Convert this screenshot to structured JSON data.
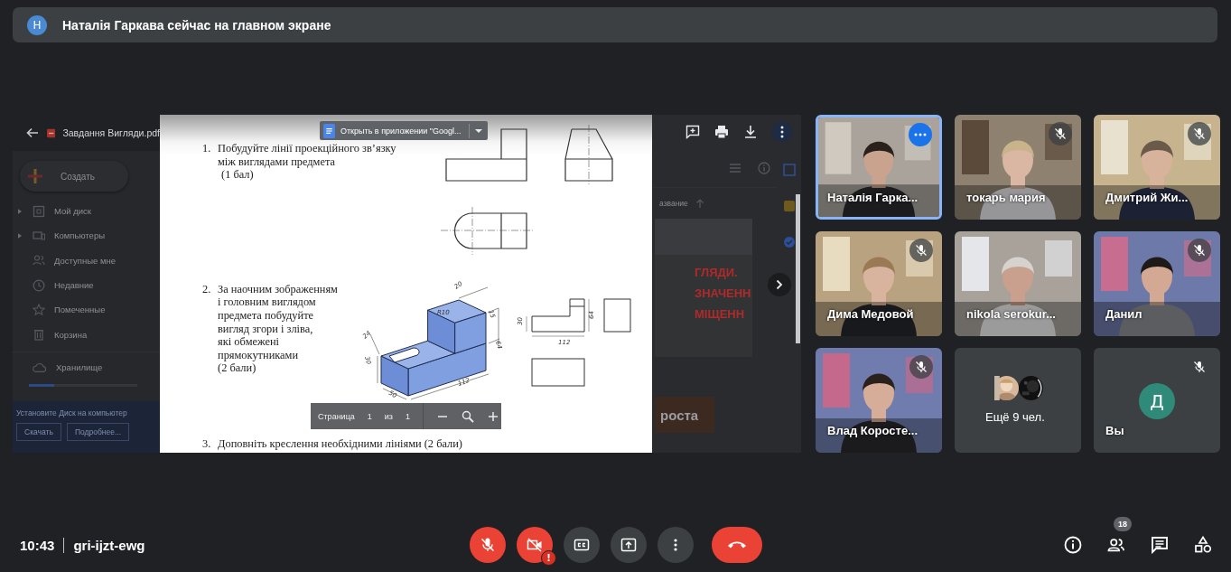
{
  "banner": {
    "avatar": "Н",
    "text": "Наталія Гаркава сейчас на главном экране"
  },
  "shared_screen": {
    "drive": {
      "file_name": "Завдання Вигляди.pdf",
      "create": "Создать",
      "storage": "Хранилище",
      "install": "Установите Диск на компьютер",
      "download": "Скачать",
      "more_info": "Подробнее...",
      "items": [
        {
          "label": "Мой диск",
          "expandable": true
        },
        {
          "label": "Компьютеры",
          "expandable": true
        },
        {
          "label": "Доступные мне",
          "expandable": false
        },
        {
          "label": "Недавние",
          "expandable": false
        },
        {
          "label": "Помеченные",
          "expandable": false
        },
        {
          "label": "Корзина",
          "expandable": false
        }
      ]
    },
    "open_in_app": "Открыть в приложении \"Googl...",
    "tasks": [
      {
        "number": "1.",
        "lines": [
          "Побудуйте лінії проекційного зв’язку",
          "між виглядами предмета",
          "(1 бал)"
        ]
      },
      {
        "number": "2.",
        "lines": [
          "За наочним зображенням",
          "і головним виглядом",
          "предмета побудуйте",
          "вигляд згори і зліва,",
          "які обмежені",
          "прямокутниками",
          "(2 бали)"
        ]
      },
      {
        "number": "3.",
        "lines": [
          "Доповніть креслення необхідними лініями (2 бали)"
        ]
      }
    ],
    "iso_dimensions": [
      "20",
      "15",
      "64",
      "R10",
      "24",
      "30",
      "50",
      "112"
    ],
    "view_dimensions": [
      "30",
      "64",
      "112"
    ],
    "pager": {
      "label": "Страница",
      "current": "1",
      "of": "из",
      "total": "1"
    },
    "background": {
      "sort_label": "азвание",
      "headings": [
        "ГЛЯДИ.",
        "ЗНАЧЕНН",
        "МІЩЕНН"
      ],
      "thumbnail_text": "роста"
    }
  },
  "participants": [
    {
      "kind": "video",
      "name": "Наталія Гарка...",
      "muted": false,
      "selected": true
    },
    {
      "kind": "video",
      "name": "токарь мария",
      "muted": true,
      "selected": false
    },
    {
      "kind": "video",
      "name": "Дмитрий Жи...",
      "muted": true,
      "selected": false
    },
    {
      "kind": "video",
      "name": "Дима Медовой",
      "muted": true,
      "selected": false
    },
    {
      "kind": "video",
      "name": "nikola serokur...",
      "muted": false,
      "selected": false
    },
    {
      "kind": "video",
      "name": "Данил",
      "muted": true,
      "selected": false
    },
    {
      "kind": "video",
      "name": "Влад Коросте...",
      "muted": true,
      "selected": false
    },
    {
      "kind": "more",
      "name": "Ещё 9 чел.",
      "muted": false,
      "selected": false
    },
    {
      "kind": "self",
      "name": "Вы",
      "avatar": "Д",
      "muted": true,
      "selected": false
    }
  ],
  "meeting": {
    "time": "10:43",
    "code": "gri-ijzt-ewg"
  },
  "controls": [
    {
      "kind": "mic",
      "on": false
    },
    {
      "kind": "camera",
      "on": false,
      "alert": "!"
    },
    {
      "kind": "captions",
      "on": false
    },
    {
      "kind": "present"
    },
    {
      "kind": "more"
    },
    {
      "kind": "leave"
    }
  ],
  "side_actions": [
    {
      "kind": "info"
    },
    {
      "kind": "people",
      "badge": "18"
    },
    {
      "kind": "chat"
    },
    {
      "kind": "activities"
    }
  ]
}
